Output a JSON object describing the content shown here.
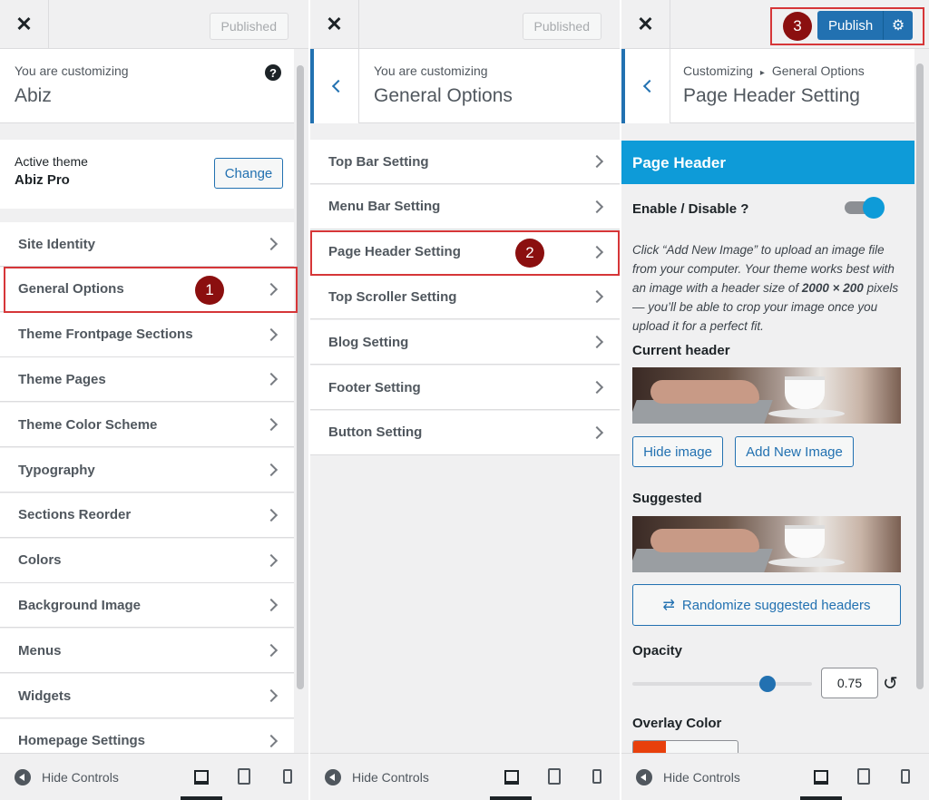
{
  "panel1": {
    "published_label": "Published",
    "customizing_label": "You are customizing",
    "site_name": "Abiz",
    "help_icon": "question-circle-icon",
    "active_theme_label": "Active theme",
    "theme_name": "Abiz Pro",
    "change_label": "Change",
    "menu": [
      "Site Identity",
      "General Options",
      "Theme Frontpage Sections",
      "Theme Pages",
      "Theme Color Scheme",
      "Typography",
      "Sections Reorder",
      "Colors",
      "Background Image",
      "Menus",
      "Widgets",
      "Homepage Settings"
    ],
    "step_badge": "1",
    "hide_controls": "Hide Controls"
  },
  "panel2": {
    "published_label": "Published",
    "customizing_label": "You are customizing",
    "section_title": "General Options",
    "menu": [
      "Top Bar Setting",
      "Menu Bar Setting",
      "Page Header Setting",
      "Top Scroller Setting",
      "Blog Setting",
      "Footer Setting",
      "Button Setting"
    ],
    "step_badge": "2",
    "hide_controls": "Hide Controls"
  },
  "panel3": {
    "step_badge": "3",
    "publish_label": "Publish",
    "breadcrumb_root": "Customizing",
    "breadcrumb_sep": "▸",
    "breadcrumb_section": "General Options",
    "title": "Page Header Setting",
    "section_heading": "Page Header",
    "toggle_label": "Enable / Disable ?",
    "toggle_on": true,
    "description_part1": "Click “Add New Image” to upload an image file from your computer. Your theme works best with an image with a header size of ",
    "description_size": "2000 × 200",
    "description_part2": " pixels — you’ll be able to crop your image once you upload it for a perfect fit.",
    "current_header_label": "Current header",
    "hide_image_label": "Hide image",
    "add_new_image_label": "Add New Image",
    "suggested_label": "Suggested",
    "randomize_label": "Randomize suggested headers",
    "opacity_label": "Opacity",
    "opacity_value": "0.75",
    "opacity_fraction": 0.75,
    "overlay_color_label": "Overlay Color",
    "overlay_color": "#e8400c",
    "hide_controls": "Hide Controls"
  },
  "colors": {
    "accent": "#2271b1",
    "header_bar": "#0e9bd8",
    "badge": "#8b0f0f",
    "highlight": "#d63638"
  }
}
